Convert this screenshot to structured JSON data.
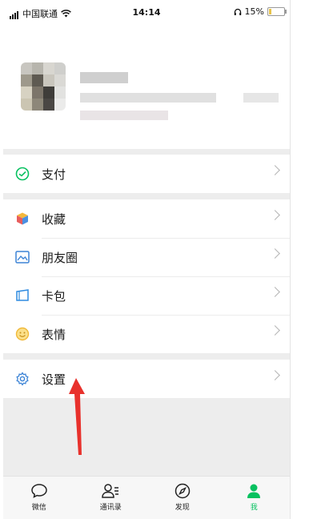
{
  "status_bar": {
    "carrier": "中国联通",
    "time": "14:14",
    "battery": "15%",
    "battery_level": 0.15
  },
  "menu": {
    "pay": {
      "label": "支付",
      "icon": "wechat-pay-icon"
    },
    "favorites": {
      "label": "收藏",
      "icon": "cube-icon"
    },
    "moments": {
      "label": "朋友圈",
      "icon": "image-icon"
    },
    "cards": {
      "label": "卡包",
      "icon": "card-icon"
    },
    "stickers": {
      "label": "表情",
      "icon": "smiley-icon"
    },
    "settings": {
      "label": "设置",
      "icon": "gear-icon"
    }
  },
  "tabbar": [
    {
      "label": "微信",
      "icon": "chat-bubble-icon"
    },
    {
      "label": "通讯录",
      "icon": "contacts-icon"
    },
    {
      "label": "发现",
      "icon": "compass-icon"
    },
    {
      "label": "我",
      "icon": "person-icon"
    }
  ],
  "colors": {
    "accent_green": "#07c160",
    "annotation_red": "#e8312c",
    "background": "#ededed"
  }
}
